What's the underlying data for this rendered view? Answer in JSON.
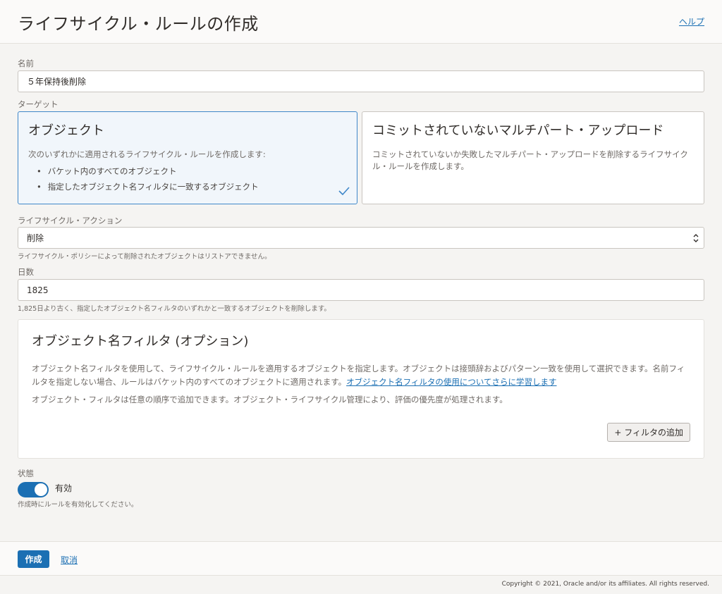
{
  "header": {
    "title": "ライフサイクル・ルールの作成",
    "help_label": "ヘルプ"
  },
  "form": {
    "name": {
      "label": "名前",
      "value": "５年保持後削除"
    },
    "target": {
      "label": "ターゲット",
      "cards": [
        {
          "title": "オブジェクト",
          "description": "次のいずれかに適用されるライフサイクル・ルールを作成します:",
          "bullets": [
            "バケット内のすべてのオブジェクト",
            "指定したオブジェクト名フィルタに一致するオブジェクト"
          ],
          "selected": true
        },
        {
          "title": "コミットされていないマルチパート・アップロード",
          "description": "コミットされていないか失敗したマルチパート・アップロードを削除するライフサイクル・ルールを作成します。",
          "selected": false
        }
      ]
    },
    "action": {
      "label": "ライフサイクル・アクション",
      "value": "削除",
      "hint": "ライフサイクル・ポリシーによって削除されたオブジェクトはリストアできません。"
    },
    "days": {
      "label": "日数",
      "value": "1825",
      "hint": "1,825日より古く、指定したオブジェクト名フィルタのいずれかと一致するオブジェクトを削除します。"
    },
    "filter": {
      "title": "オブジェクト名フィルタ (オプション)",
      "description": "オブジェクト名フィルタを使用して、ライフサイクル・ルールを適用するオブジェクトを指定します。オブジェクトは接頭辞およびパターン一致を使用して選択できます。名前フィルタを指定しない場合、ルールはバケット内のすべてのオブジェクトに適用されます。",
      "link_label": "オブジェクト名フィルタの使用についてさらに学習します",
      "description2": "オブジェクト・フィルタは任意の順序で追加できます。オブジェクト・ライフサイクル管理により、評価の優先度が処理されます。",
      "add_button_label": "+ フィルタの追加"
    },
    "state": {
      "label": "状態",
      "toggle_label": "有効",
      "enabled": true,
      "hint": "作成時にルールを有効化してください。"
    }
  },
  "footer": {
    "create_label": "作成",
    "cancel_label": "取消",
    "copyright": "Copyright © 2021, Oracle and/or its affiliates. All rights reserved."
  },
  "colors": {
    "accent": "#1b6fb3",
    "selected_card_bg": "#f1f6fb",
    "selected_card_border": "#3f87c9",
    "page_bg": "#f5f4f2"
  }
}
